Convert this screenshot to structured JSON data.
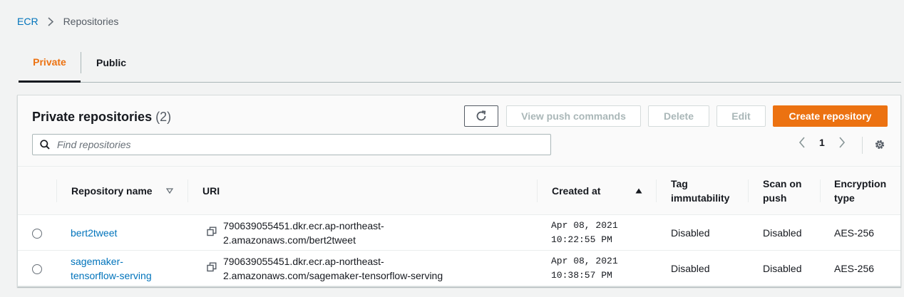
{
  "breadcrumb": {
    "root": "ECR",
    "current": "Repositories"
  },
  "tabs": [
    {
      "label": "Private"
    },
    {
      "label": "Public"
    }
  ],
  "panel": {
    "title": "Private repositories",
    "count": "(2)",
    "buttons": {
      "view_push": "View push commands",
      "delete": "Delete",
      "edit": "Edit",
      "create": "Create repository"
    },
    "search_placeholder": "Find repositories",
    "page": "1"
  },
  "columns": {
    "name": "Repository name",
    "uri": "URI",
    "created": "Created at",
    "tag_immutability": [
      "Tag",
      "immutability"
    ],
    "scan_on_push": [
      "Scan on",
      "push"
    ],
    "encryption": [
      "Encryption",
      "type"
    ]
  },
  "rows": [
    {
      "name": [
        "bert2tweet"
      ],
      "uri": [
        "790639055451.dkr.ecr.ap-northeast-",
        "2.amazonaws.com/bert2tweet"
      ],
      "created": [
        "Apr 08, 2021",
        "10:22:55 PM"
      ],
      "tag_immutability": "Disabled",
      "scan_on_push": "Disabled",
      "encryption": "AES-256"
    },
    {
      "name": [
        "sagemaker-",
        "tensorflow-serving"
      ],
      "uri": [
        "790639055451.dkr.ecr.ap-northeast-",
        "2.amazonaws.com/sagemaker-tensorflow-serving"
      ],
      "created": [
        "Apr 08, 2021",
        "10:38:57 PM"
      ],
      "tag_immutability": "Disabled",
      "scan_on_push": "Disabled",
      "encryption": "AES-256"
    }
  ],
  "colors": {
    "accent": "#ec7211",
    "link": "#0073bb",
    "text": "#16191f",
    "muted": "#545b64",
    "disabled": "#aab7b8"
  },
  "icons": [
    "chevron-right-icon",
    "refresh-icon",
    "search-icon",
    "chevron-left-icon",
    "gear-icon",
    "sort-down-icon",
    "sort-up-icon",
    "copy-icon"
  ]
}
